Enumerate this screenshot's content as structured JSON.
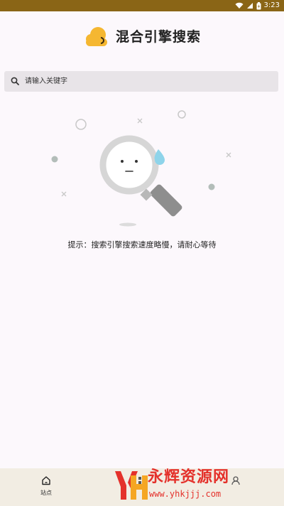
{
  "status_bar": {
    "time": "3:23"
  },
  "header": {
    "title": "混合引擎搜索"
  },
  "search": {
    "placeholder": "请输入关键字"
  },
  "empty_state": {
    "hint": "提示：搜索引擎搜索速度略慢，请耐心等待"
  },
  "bottom_nav": {
    "items": [
      {
        "label": "站点",
        "icon": "home-icon"
      },
      {
        "label": "",
        "icon": "grid-icon"
      },
      {
        "label": "",
        "icon": "user-icon"
      }
    ]
  },
  "watermark": {
    "brand": "永辉资源网",
    "url": "www.yhkjjj.com"
  },
  "colors": {
    "status_bar": "#8a6516",
    "accent": "#f5b731",
    "watermark": "#e4312b"
  }
}
